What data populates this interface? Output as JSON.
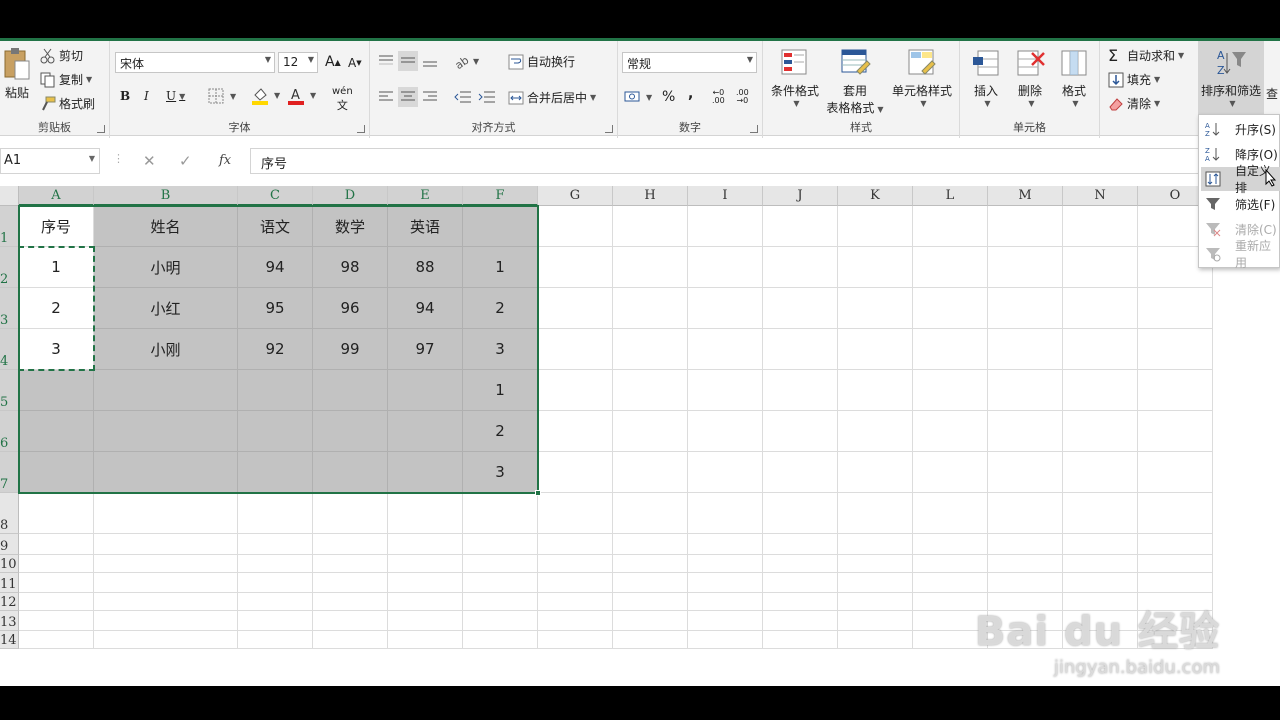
{
  "ribbon": {
    "clipboard": {
      "paste": "粘贴",
      "cut": "剪切",
      "copy": "复制",
      "format_painter": "格式刷",
      "label": "剪贴板"
    },
    "font": {
      "name": "宋体",
      "size": "12",
      "bold": "B",
      "italic": "I",
      "underline": "U",
      "grow": "A",
      "shrink": "A",
      "phonetic": "wén",
      "label": "字体"
    },
    "alignment": {
      "wrap_text": "自动换行",
      "merge_center": "合并后居中",
      "label": "对齐方式"
    },
    "number": {
      "format": "常规",
      "percent": "%",
      "comma": ",",
      "label": "数字"
    },
    "styles": {
      "conditional": "条件格式",
      "table_format_1": "套用",
      "table_format_2": "表格格式",
      "cell_styles": "单元格样式",
      "label": "样式"
    },
    "cells": {
      "insert": "插入",
      "delete": "删除",
      "format": "格式",
      "label": "单元格"
    },
    "editing": {
      "autosum": "自动求和",
      "fill": "填充",
      "clear": "清除",
      "sort_filter": "排序和筛选",
      "find": "查"
    }
  },
  "formula_bar": {
    "name_box": "A1",
    "fx": "fx",
    "content": "序号"
  },
  "columns": [
    "A",
    "B",
    "C",
    "D",
    "E",
    "F",
    "G",
    "H",
    "I",
    "J",
    "K",
    "L",
    "M",
    "N",
    "O"
  ],
  "rows": [
    "1",
    "2",
    "3",
    "4",
    "5",
    "6",
    "7",
    "8",
    "9",
    "10",
    "11",
    "12",
    "13",
    "14"
  ],
  "table": {
    "headers": [
      "序号",
      "姓名",
      "语文",
      "数学",
      "英语",
      ""
    ],
    "rows": [
      [
        "1",
        "小明",
        "94",
        "98",
        "88",
        "1"
      ],
      [
        "2",
        "小红",
        "95",
        "96",
        "94",
        "2"
      ],
      [
        "3",
        "小刚",
        "92",
        "99",
        "97",
        "3"
      ],
      [
        "",
        "",
        "",
        "",
        "",
        "1"
      ],
      [
        "",
        "",
        "",
        "",
        "",
        "2"
      ],
      [
        "",
        "",
        "",
        "",
        "",
        "3"
      ]
    ]
  },
  "sort_menu": {
    "items": [
      {
        "label": "升序(S)",
        "icon": "sort-ascending-icon"
      },
      {
        "label": "降序(O)",
        "icon": "sort-descending-icon"
      },
      {
        "label": "自定义排",
        "icon": "custom-sort-icon"
      },
      {
        "label": "筛选(F)",
        "icon": "filter-icon"
      },
      {
        "label": "清除(C)",
        "icon": "clear-filter-icon"
      },
      {
        "label": "重新应用",
        "icon": "reapply-icon"
      }
    ]
  },
  "watermark": {
    "line1": "Bai du 经验",
    "line2": "jingyan.baidu.com"
  },
  "colors": {
    "accent": "#217346",
    "selection_shade": "#c3c3c3",
    "font_color_red": "#e02020",
    "fill_yellow": "#ffd700"
  }
}
